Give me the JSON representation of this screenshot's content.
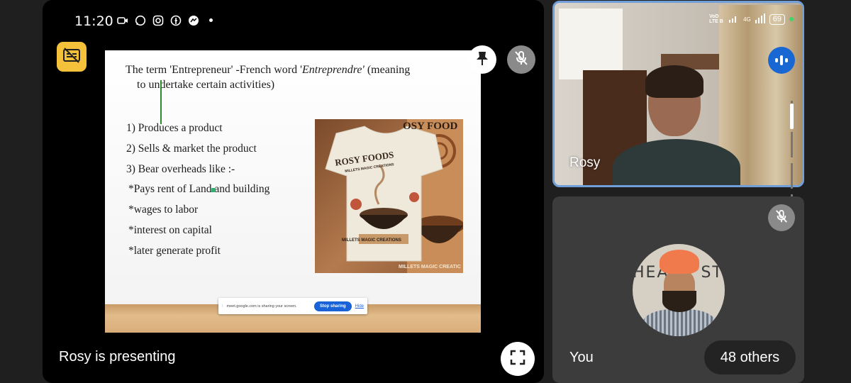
{
  "status_bar": {
    "time": "11:20",
    "icons": [
      "video-icon",
      "whatsapp-icon",
      "instagram-icon",
      "facebook-icon",
      "messenger-icon"
    ],
    "network_left": "VoD LTE B",
    "network_right": "4G",
    "battery": "69"
  },
  "main_stage": {
    "presenting_label": "Rosy is presenting",
    "accent_caption_button": "#f5c13b"
  },
  "slide": {
    "title_pre": "The term 'Entrepreneur' -French word '",
    "title_italic": "Entreprendre'",
    "title_post": " (meaning",
    "title_line2": "to undertake certain activities)",
    "points": [
      "1) Produces a product",
      "2) Sells  & market the product",
      "3) Bear overheads like :-",
      "*Pays rent of Land and building",
      "*wages to labor",
      "*interest on capital",
      "*later generate profit"
    ],
    "image": {
      "brand_text": "ROSY FOODS",
      "brand_sub": "MILLETS MAGIC CREATIONS",
      "banner_text": "MILLETS MAGIC CREATIONS",
      "right_top_text": "OSY FOOD",
      "right_bottom_text": "MILLETS MAGIC CREATIC"
    },
    "share_bar": {
      "message": "meet.google.com is sharing your screen.",
      "stop_label": "Stop sharing",
      "hide_label": "Hide"
    }
  },
  "tiles": {
    "rosy": {
      "name": "Rosy",
      "border_color": "#6f9ed8"
    },
    "you": {
      "name": "You",
      "others_label": "48 others"
    }
  }
}
